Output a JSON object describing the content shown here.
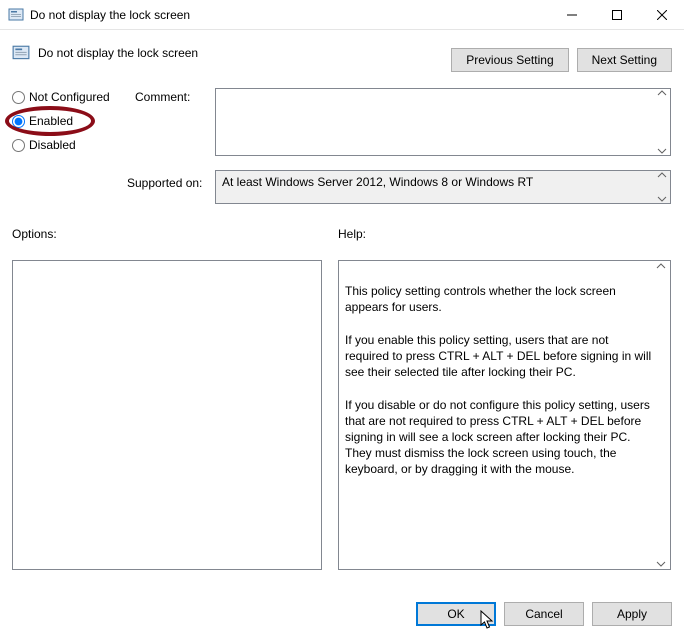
{
  "window": {
    "title": "Do not display the lock screen",
    "header_title": "Do not display the lock screen"
  },
  "nav": {
    "previous": "Previous Setting",
    "next": "Next Setting"
  },
  "radios": {
    "not_configured": "Not Configured",
    "enabled": "Enabled",
    "disabled": "Disabled",
    "selected": "enabled"
  },
  "labels": {
    "comment": "Comment:",
    "supported": "Supported on:",
    "options": "Options:",
    "help": "Help:"
  },
  "fields": {
    "comment_value": "",
    "supported_value": "At least Windows Server 2012, Windows 8 or Windows RT"
  },
  "help_text": "This policy setting controls whether the lock screen appears for users.\n\nIf you enable this policy setting, users that are not required to press CTRL + ALT + DEL before signing in will see their selected tile after locking their PC.\n\nIf you disable or do not configure this policy setting, users that are not required to press CTRL + ALT + DEL before signing in will see a lock screen after locking their PC. They must dismiss the lock screen using touch, the keyboard, or by dragging it with the mouse.",
  "footer": {
    "ok": "OK",
    "cancel": "Cancel",
    "apply": "Apply"
  }
}
